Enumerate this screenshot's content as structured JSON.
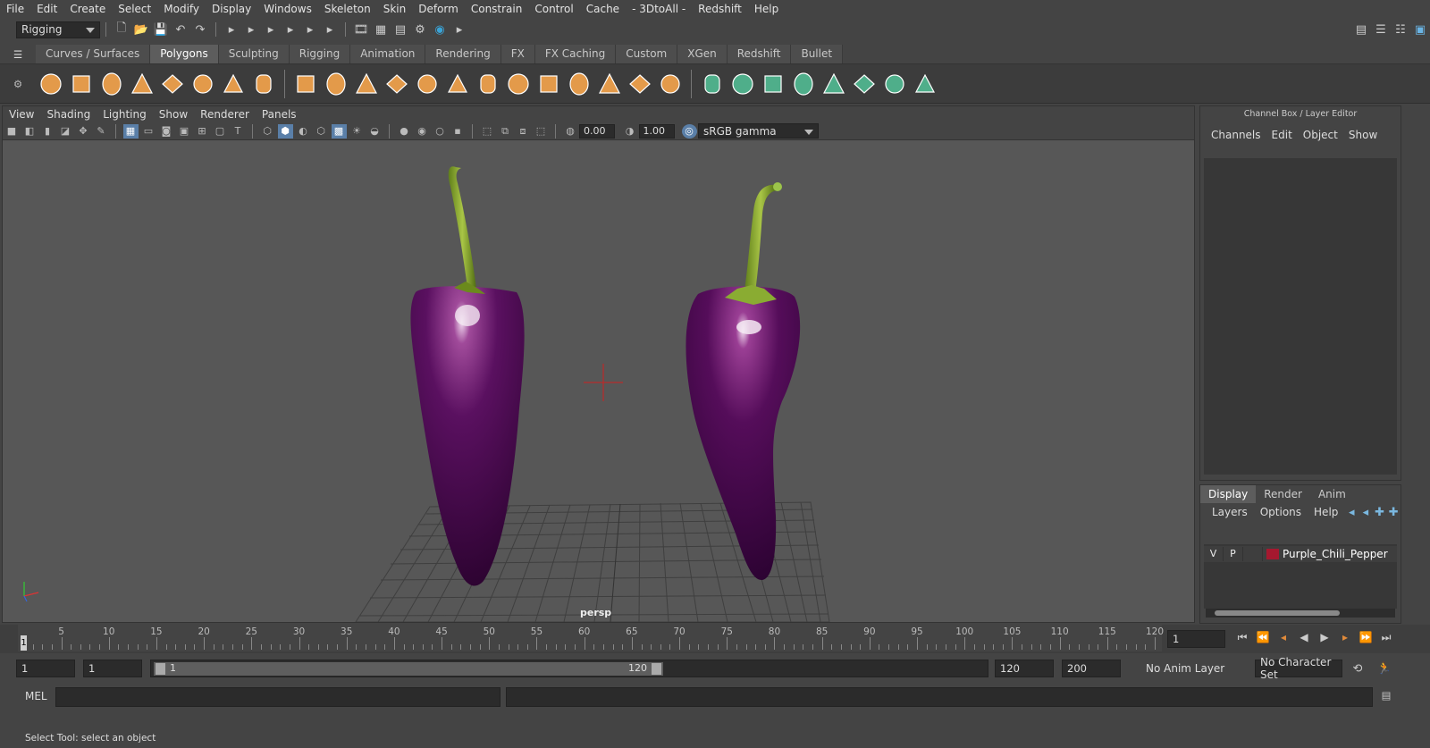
{
  "menubar": [
    "File",
    "Edit",
    "Create",
    "Select",
    "Modify",
    "Display",
    "Windows",
    "Skeleton",
    "Skin",
    "Deform",
    "Constrain",
    "Control",
    "Cache",
    "- 3DtoAll -",
    "Redshift",
    "Help"
  ],
  "toolbar": {
    "menuset": "Rigging"
  },
  "shelf_tabs": [
    "Curves / Surfaces",
    "Polygons",
    "Sculpting",
    "Rigging",
    "Animation",
    "Rendering",
    "FX",
    "FX Caching",
    "Custom",
    "XGen",
    "Redshift",
    "Bullet"
  ],
  "shelf_active": "Polygons",
  "viewport": {
    "menu": [
      "View",
      "Shading",
      "Lighting",
      "Show",
      "Renderer",
      "Panels"
    ],
    "exposure": "0.00",
    "gamma": "1.00",
    "colorspace": "sRGB gamma",
    "camera_label": "persp"
  },
  "channel_box": {
    "title": "Channel Box / Layer Editor",
    "menu": [
      "Channels",
      "Edit",
      "Object",
      "Show"
    ]
  },
  "layer_editor": {
    "tabs": [
      "Display",
      "Render",
      "Anim"
    ],
    "active_tab": "Display",
    "menu": [
      "Layers",
      "Options",
      "Help"
    ],
    "layers": [
      {
        "v": "V",
        "p": "P",
        "name": "Purple_Chili_Pepper",
        "color": "#a5182f"
      }
    ]
  },
  "timeline": {
    "labels": [
      "5",
      "10",
      "15",
      "20",
      "25",
      "30",
      "35",
      "40",
      "45",
      "50",
      "55",
      "60",
      "65",
      "70",
      "75",
      "80",
      "85",
      "90",
      "95",
      "100",
      "105",
      "110",
      "115",
      "120"
    ],
    "current": "1",
    "current_field": "1"
  },
  "range": {
    "start_anim": "1",
    "start_play": "1",
    "slider_start": "1",
    "slider_end": "120",
    "end_play": "120",
    "end_anim": "200",
    "anim_layer": "No Anim Layer",
    "char_set": "No Character Set"
  },
  "cmdline": {
    "lang": "MEL"
  },
  "status": "Select Tool: select an object"
}
